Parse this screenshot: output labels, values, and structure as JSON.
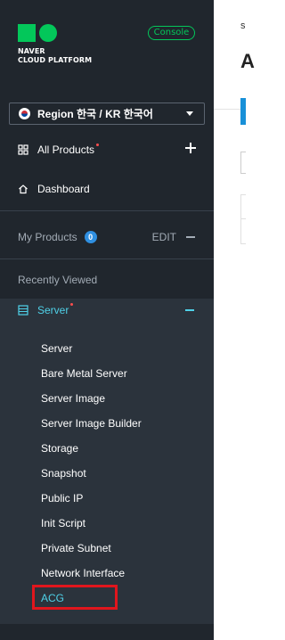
{
  "brand": {
    "line1": "NAVER",
    "line2": "CLOUD PLATFORM",
    "console_label": "Console",
    "accent": "#03c75a"
  },
  "region": {
    "label": "Region 한국 / KR 한국어"
  },
  "nav": {
    "all_products": "All Products",
    "dashboard": "Dashboard",
    "my_products": "My Products",
    "my_products_count": "0",
    "edit": "EDIT",
    "recently_viewed": "Recently Viewed"
  },
  "server": {
    "label": "Server",
    "items": [
      {
        "label": "Server"
      },
      {
        "label": "Bare Metal Server"
      },
      {
        "label": "Server Image"
      },
      {
        "label": "Server Image Builder"
      },
      {
        "label": "Storage"
      },
      {
        "label": "Snapshot"
      },
      {
        "label": "Public IP"
      },
      {
        "label": "Init Script"
      },
      {
        "label": "Private Subnet"
      },
      {
        "label": "Network Interface"
      },
      {
        "label": "ACG"
      }
    ]
  },
  "content": {
    "partial_letter_small": "s",
    "partial_letter_large": "A"
  },
  "colors": {
    "sidebar_bg": "#20262d",
    "submenu_bg": "#2b333c",
    "active_text": "#4fd1e8",
    "highlight": "#e0161d",
    "badge": "#2f8fe0"
  }
}
